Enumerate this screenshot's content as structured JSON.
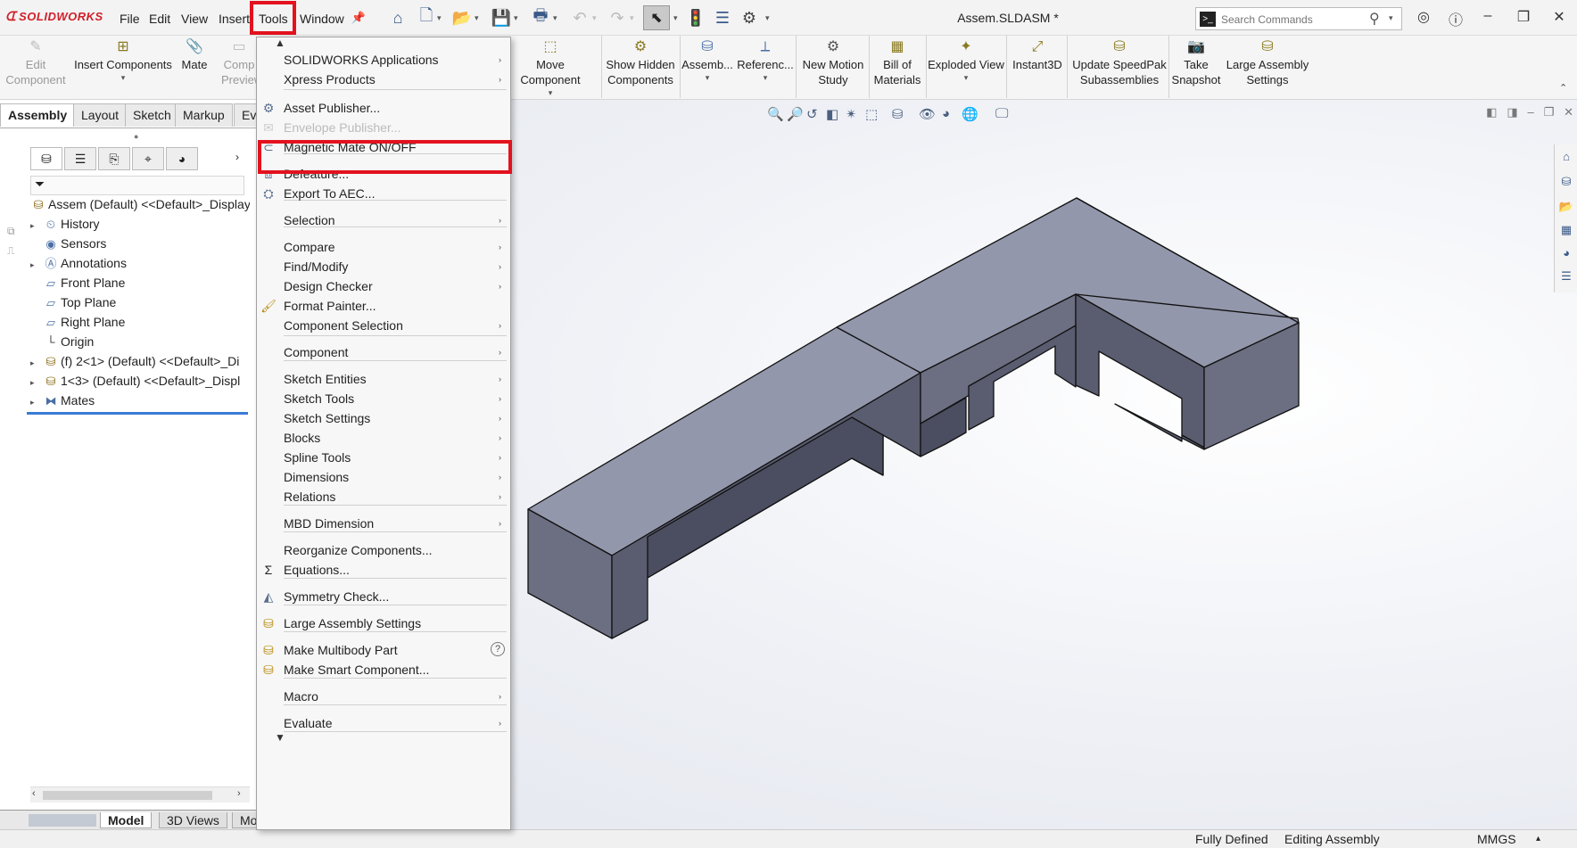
{
  "app": {
    "logo_text": "SOLIDWORKS",
    "doc_title": "Assem.SLDASM *"
  },
  "menubar": {
    "file": "File",
    "edit": "Edit",
    "view": "View",
    "insert": "Insert",
    "tools": "Tools",
    "window": "Window"
  },
  "search": {
    "placeholder": "Search Commands"
  },
  "commands": {
    "edit_component": "Edit Component",
    "insert_components": "Insert Components",
    "mate": "Mate",
    "component_preview": "Comp Preview",
    "move_component": "Move Component",
    "show_hidden": "Show Hidden Components",
    "assembly": "Assemb...",
    "reference": "Referenc...",
    "new_motion": "New Motion Study",
    "bom": "Bill of Materials",
    "exploded": "Exploded View",
    "instant3d": "Instant3D",
    "speedpak": "Update SpeedPak Subassemblies",
    "snapshot": "Take Snapshot",
    "large_assembly": "Large Assembly Settings"
  },
  "tabs": [
    "Assembly",
    "Layout",
    "Sketch",
    "Markup",
    "Ev"
  ],
  "tree": [
    {
      "label": "Assem (Default) <<Default>_Display",
      "icon": "assembly-icon",
      "expand": ""
    },
    {
      "label": "History",
      "icon": "history-icon",
      "expand": "▸"
    },
    {
      "label": "Sensors",
      "icon": "sensors-icon",
      "expand": ""
    },
    {
      "label": "Annotations",
      "icon": "annotations-icon",
      "expand": "▸"
    },
    {
      "label": "Front Plane",
      "icon": "plane-icon",
      "expand": ""
    },
    {
      "label": "Top Plane",
      "icon": "plane-icon",
      "expand": ""
    },
    {
      "label": "Right Plane",
      "icon": "plane-icon",
      "expand": ""
    },
    {
      "label": "Origin",
      "icon": "origin-icon",
      "expand": ""
    },
    {
      "label": "(f) 2<1> (Default) <<Default>_Di",
      "icon": "part-icon",
      "expand": "▸"
    },
    {
      "label": "1<3> (Default) <<Default>_Displ",
      "icon": "part-icon",
      "expand": "▸"
    },
    {
      "label": "Mates",
      "icon": "mates-icon",
      "expand": "▸"
    }
  ],
  "bottom_tabs": {
    "model": "Model",
    "views3d": "3D Views",
    "motion": "Mo"
  },
  "status": {
    "defined": "Fully Defined",
    "editing": "Editing Assembly",
    "units": "MMGS",
    "units_arrow": "▴"
  },
  "tools_menu": {
    "items": [
      {
        "label": "SOLIDWORKS Applications",
        "submenu": "›",
        "icon": ""
      },
      {
        "label": "Xpress Products",
        "submenu": "›",
        "icon": ""
      },
      {
        "label": "Asset Publisher...",
        "submenu": "",
        "icon": "asset-publisher-icon"
      },
      {
        "label": "Envelope Publisher...",
        "submenu": "",
        "icon": "envelope-publisher-icon"
      },
      {
        "label": "Magnetic Mate ON/OFF",
        "submenu": "",
        "icon": "magnetic-mate-icon"
      },
      {
        "label": "Defeature...",
        "submenu": "",
        "icon": "defeature-icon"
      },
      {
        "label": "Export To AEC...",
        "submenu": "",
        "icon": "export-aec-icon"
      },
      {
        "label": "Selection",
        "submenu": "›",
        "icon": ""
      },
      {
        "label": "Compare",
        "submenu": "›",
        "icon": ""
      },
      {
        "label": "Find/Modify",
        "submenu": "›",
        "icon": ""
      },
      {
        "label": "Design Checker",
        "submenu": "›",
        "icon": ""
      },
      {
        "label": "Format Painter...",
        "submenu": "",
        "icon": "format-painter-icon"
      },
      {
        "label": "Component Selection",
        "submenu": "›",
        "icon": ""
      },
      {
        "label": "Component",
        "submenu": "›",
        "icon": ""
      },
      {
        "label": "Sketch Entities",
        "submenu": "›",
        "icon": ""
      },
      {
        "label": "Sketch Tools",
        "submenu": "›",
        "icon": ""
      },
      {
        "label": "Sketch Settings",
        "submenu": "›",
        "icon": ""
      },
      {
        "label": "Blocks",
        "submenu": "›",
        "icon": ""
      },
      {
        "label": "Spline Tools",
        "submenu": "›",
        "icon": ""
      },
      {
        "label": "Dimensions",
        "submenu": "›",
        "icon": ""
      },
      {
        "label": "Relations",
        "submenu": "›",
        "icon": ""
      },
      {
        "label": "MBD Dimension",
        "submenu": "›",
        "icon": ""
      },
      {
        "label": "Reorganize Components...",
        "submenu": "",
        "icon": ""
      },
      {
        "label": "Equations...",
        "submenu": "",
        "icon": "equations-icon"
      },
      {
        "label": "Symmetry Check...",
        "submenu": "",
        "icon": "symmetry-check-icon"
      },
      {
        "label": "Large Assembly Settings",
        "submenu": "",
        "icon": "large-assembly-icon"
      },
      {
        "label": "Make Multibody Part",
        "submenu": "",
        "icon": "multibody-icon"
      },
      {
        "label": "Make Smart Component...",
        "submenu": "",
        "icon": "smart-component-icon"
      },
      {
        "label": "Macro",
        "submenu": "›",
        "icon": ""
      },
      {
        "label": "Evaluate",
        "submenu": "›",
        "icon": ""
      }
    ],
    "help_glyph": "?"
  }
}
